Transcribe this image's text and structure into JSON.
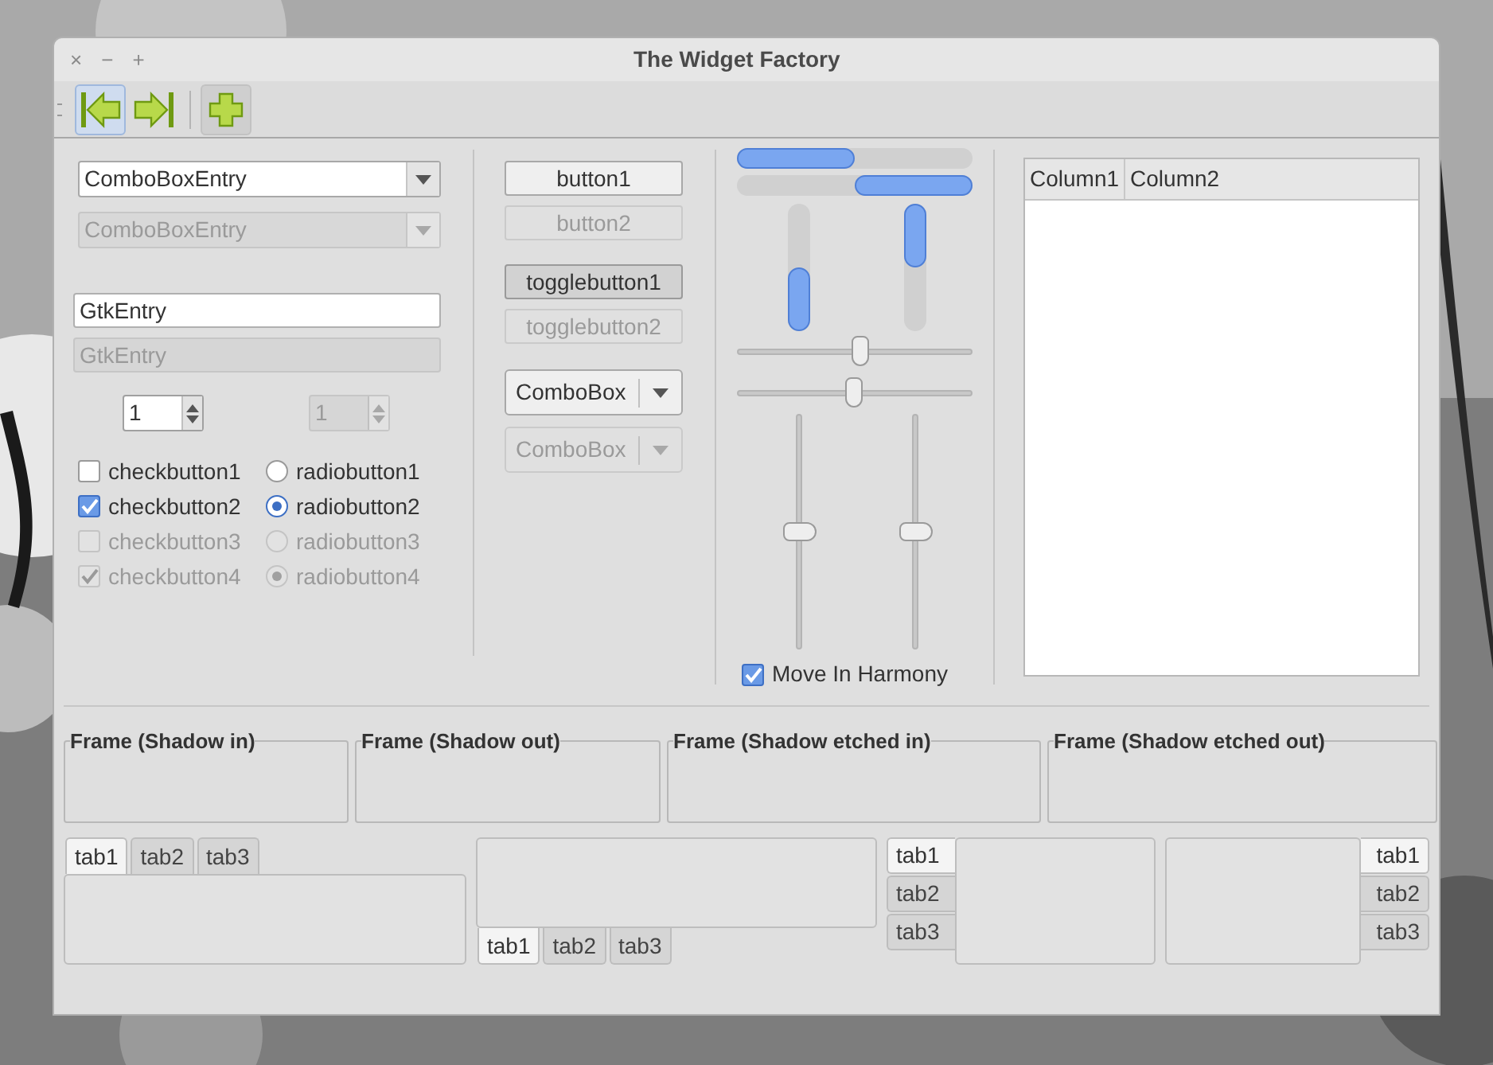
{
  "window": {
    "title": "The Widget Factory",
    "controls": [
      "×",
      "−",
      "+"
    ]
  },
  "toolbar": [
    {
      "kind": "back",
      "hover": true,
      "pressed": false
    },
    {
      "kind": "forward",
      "hover": false,
      "pressed": false
    },
    {
      "kind": "separator"
    },
    {
      "kind": "add",
      "hover": false,
      "pressed": true
    }
  ],
  "combo_entries": [
    {
      "value": "ComboBoxEntry",
      "disabled": false
    },
    {
      "value": "ComboBoxEntry",
      "disabled": true
    }
  ],
  "entries": [
    {
      "value": "GtkEntry",
      "disabled": false
    },
    {
      "value": "GtkEntry",
      "disabled": true
    }
  ],
  "spin_buttons": [
    {
      "value": "1",
      "disabled": false
    },
    {
      "value": "1",
      "disabled": true
    }
  ],
  "check_buttons": [
    {
      "label": "checkbutton1",
      "checked": false,
      "disabled": false
    },
    {
      "label": "checkbutton2",
      "checked": true,
      "disabled": false
    },
    {
      "label": "checkbutton3",
      "checked": false,
      "disabled": true
    },
    {
      "label": "checkbutton4",
      "checked": true,
      "disabled": true
    }
  ],
  "radio_buttons": [
    {
      "label": "radiobutton1",
      "selected": false,
      "disabled": false
    },
    {
      "label": "radiobutton2",
      "selected": true,
      "disabled": false
    },
    {
      "label": "radiobutton3",
      "selected": false,
      "disabled": true
    },
    {
      "label": "radiobutton4",
      "selected": true,
      "disabled": true
    }
  ],
  "buttons": [
    {
      "label": "button1",
      "disabled": false
    },
    {
      "label": "button2",
      "disabled": true
    }
  ],
  "toggle_buttons": [
    {
      "label": "togglebutton1",
      "active": true,
      "disabled": false
    },
    {
      "label": "togglebutton2",
      "active": false,
      "disabled": true
    }
  ],
  "combo_boxes": [
    {
      "value": "ComboBox",
      "disabled": false
    },
    {
      "value": "ComboBox",
      "disabled": true
    }
  ],
  "progress_bars": [
    {
      "level": 0.5,
      "inverted": false
    },
    {
      "level": 0.5,
      "inverted": true
    }
  ],
  "vertical_progress_bars": [
    {
      "level": 0.5,
      "inverted": false
    },
    {
      "level": 0.5,
      "inverted": true
    }
  ],
  "scales": [
    {
      "level": 0.53
    },
    {
      "level": 0.5
    }
  ],
  "vertical_scales": [
    {
      "level": 0.5
    },
    {
      "level": 0.5
    }
  ],
  "harmony_check": {
    "label": "Move In Harmony",
    "checked": true
  },
  "tree": {
    "columns": [
      "Column1",
      "Column2"
    ]
  },
  "frames": [
    {
      "label": "Frame (Shadow in)"
    },
    {
      "label": "Frame (Shadow out)"
    },
    {
      "label": "Frame (Shadow etched in)"
    },
    {
      "label": "Frame (Shadow etched out)"
    }
  ],
  "notebooks": [
    {
      "kind": "top",
      "tabs": [
        {
          "label": "tab1",
          "selected": true
        },
        {
          "label": "tab2",
          "selected": false
        },
        {
          "label": "tab3",
          "selected": false
        }
      ]
    },
    {
      "kind": "bottom",
      "tabs": [
        {
          "label": "tab1",
          "selected": true
        },
        {
          "label": "tab2",
          "selected": false
        },
        {
          "label": "tab3",
          "selected": false
        }
      ]
    },
    {
      "kind": "left",
      "tabs": [
        {
          "label": "tab1",
          "selected": true
        },
        {
          "label": "tab2",
          "selected": false
        },
        {
          "label": "tab3",
          "selected": false
        }
      ]
    },
    {
      "kind": "right",
      "tabs": [
        {
          "label": "tab1",
          "selected": true
        },
        {
          "label": "tab2",
          "selected": false
        },
        {
          "label": "tab3",
          "selected": false
        }
      ]
    }
  ]
}
